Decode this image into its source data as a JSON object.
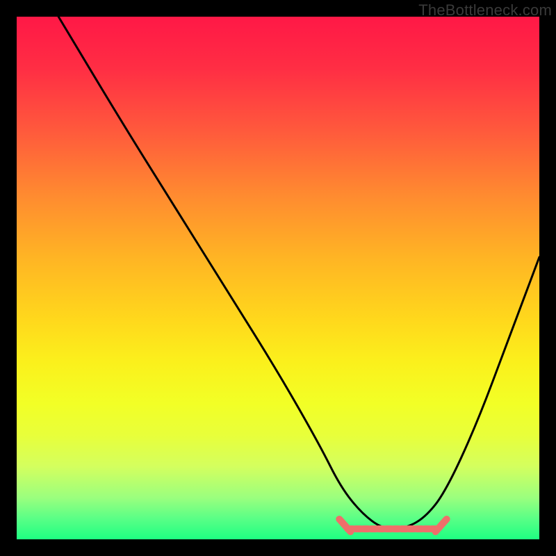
{
  "watermark": "TheBottleneck.com",
  "chart_data": {
    "type": "line",
    "title": "",
    "xlabel": "",
    "ylabel": "",
    "xlim": [
      0,
      100
    ],
    "ylim": [
      0,
      100
    ],
    "grid": false,
    "legend": false,
    "series": [
      {
        "name": "curve",
        "color": "#000000",
        "x": [
          8,
          20,
          30,
          40,
          50,
          58,
          62,
          66,
          70,
          74,
          78,
          82,
          88,
          94,
          100
        ],
        "y": [
          100,
          80,
          64,
          48,
          32,
          18,
          10,
          5,
          2,
          2,
          4,
          9,
          22,
          38,
          54
        ]
      }
    ],
    "flat_segment": {
      "name": "thick-marker",
      "color": "#ef6f6a",
      "endcap_color": "#ef6f6a",
      "y": 2,
      "x_start": 62,
      "x_end": 82
    }
  }
}
